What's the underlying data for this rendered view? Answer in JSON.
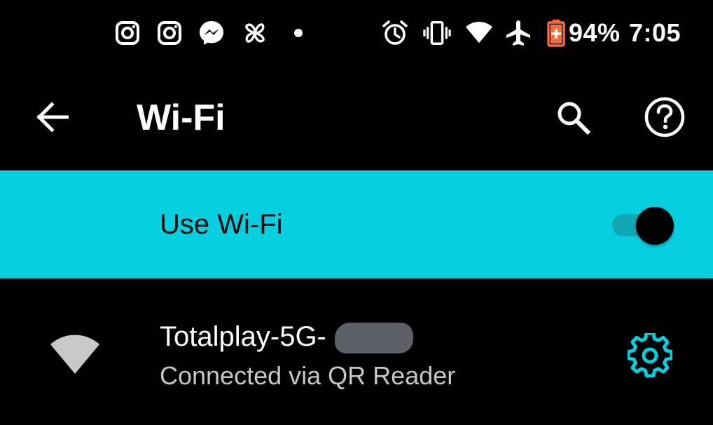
{
  "status_bar": {
    "battery_percent": "94%",
    "time": "7:05",
    "notification_icons": [
      "instagram-icon",
      "instagram-icon",
      "messenger-icon",
      "pinwheel-icon",
      "more-dot-icon"
    ],
    "system_icons": [
      "alarm-icon",
      "vibrate-icon",
      "wifi-signal-icon",
      "airplane-icon",
      "battery-saver-icon"
    ]
  },
  "app_bar": {
    "title": "Wi-Fi",
    "back_icon": "arrow-back-icon",
    "search_icon": "search-icon",
    "help_icon": "help-icon"
  },
  "use_wifi": {
    "label": "Use Wi-Fi",
    "enabled": true
  },
  "network": {
    "name": "Totalplay-5G-",
    "status": "Connected via QR Reader",
    "settings_icon": "gear-icon"
  },
  "colors": {
    "accent": "#07cfe0",
    "toggle_track": "#12a7b4",
    "battery_red": "#ff6a3d",
    "background": "#000000"
  }
}
